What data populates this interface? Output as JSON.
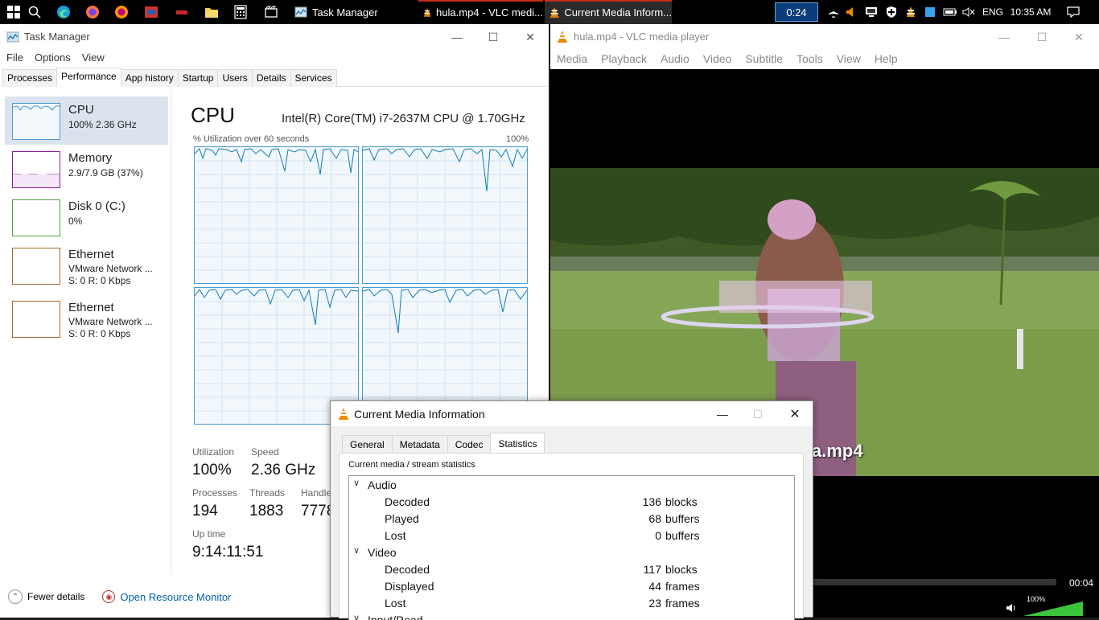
{
  "taskbar": {
    "tasks": [
      {
        "label": "Task Manager"
      },
      {
        "label": "hula.mp4 - VLC medi..."
      },
      {
        "label": "Current Media Inform..."
      }
    ],
    "tray": {
      "timer": "0:24",
      "language": "ENG",
      "clock": "10:35 AM"
    }
  },
  "task_manager": {
    "title": "Task Manager",
    "menu": [
      "File",
      "Options",
      "View"
    ],
    "tabs": [
      "Processes",
      "Performance",
      "App history",
      "Startup",
      "Users",
      "Details",
      "Services"
    ],
    "sidebar": [
      {
        "name": "CPU",
        "line1": "100%  2.36 GHz",
        "line2": ""
      },
      {
        "name": "Memory",
        "line1": "2.9/7.9 GB (37%)",
        "line2": ""
      },
      {
        "name": "Disk 0 (C:)",
        "line1": "0%",
        "line2": ""
      },
      {
        "name": "Ethernet",
        "line1": "VMware Network ...",
        "line2": "S: 0 R: 0 Kbps"
      },
      {
        "name": "Ethernet",
        "line1": "VMware Network ...",
        "line2": "S: 0 R: 0 Kbps"
      }
    ],
    "cpu": {
      "heading": "CPU",
      "model": "Intel(R) Core(TM) i7-2637M CPU @ 1.70GHz",
      "graph_label": "% Utilization over 60 seconds",
      "graph_max": "100%"
    },
    "stats": {
      "utilization_label": "Utilization",
      "utilization_value": "100%",
      "speed_label": "Speed",
      "speed_value": "2.36 GHz",
      "processes_label": "Processes",
      "processes_value": "194",
      "threads_label": "Threads",
      "threads_value": "1883",
      "handles_label": "Handle",
      "handles_value": "7778",
      "uptime_label": "Up time",
      "uptime_value": "9:14:11:51"
    },
    "footer": {
      "fewer_details": "Fewer details",
      "resource_monitor": "Open Resource Monitor"
    }
  },
  "vlc": {
    "title": "hula.mp4 - VLC media player",
    "menu": [
      "Media",
      "Playback",
      "Audio",
      "Video",
      "Subtitle",
      "Tools",
      "View",
      "Help"
    ],
    "overlay_text": "a.mp4",
    "time_elapsed": "00:04",
    "volume": "100%",
    "progress_fraction": 0.12
  },
  "media_info": {
    "title": "Current Media Information",
    "tabs": [
      "General",
      "Metadata",
      "Codec",
      "Statistics"
    ],
    "heading": "Current media / stream statistics",
    "groups": [
      {
        "name": "Audio",
        "rows": [
          {
            "label": "Decoded",
            "value": "136",
            "unit": "blocks"
          },
          {
            "label": "Played",
            "value": "68",
            "unit": "buffers"
          },
          {
            "label": "Lost",
            "value": "0",
            "unit": "buffers"
          }
        ]
      },
      {
        "name": "Video",
        "rows": [
          {
            "label": "Decoded",
            "value": "117",
            "unit": "blocks"
          },
          {
            "label": "Displayed",
            "value": "44",
            "unit": "frames"
          },
          {
            "label": "Lost",
            "value": "23",
            "unit": "frames"
          }
        ]
      }
    ],
    "partial_next": "Input/Read"
  }
}
